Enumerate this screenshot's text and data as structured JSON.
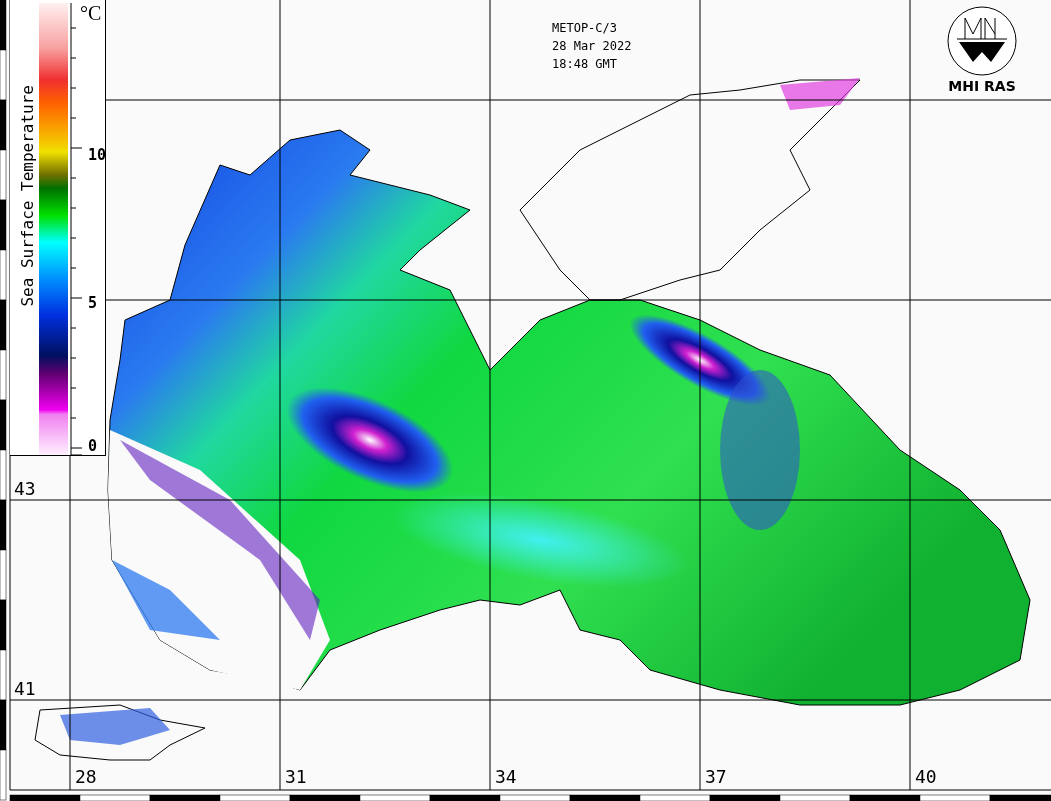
{
  "header": {
    "satellite": "METOP-C/3",
    "date": "28 Mar 2022",
    "time": "18:48 GMT"
  },
  "logo": {
    "text": "MHI RAS"
  },
  "colorbar": {
    "title": "Sea Surface Temperature",
    "unit": "°C",
    "ticks": [
      "10",
      "5",
      "0"
    ]
  },
  "latitude_labels": [
    "43",
    "41"
  ],
  "longitude_labels": [
    "28",
    "31",
    "34",
    "37",
    "40"
  ]
}
